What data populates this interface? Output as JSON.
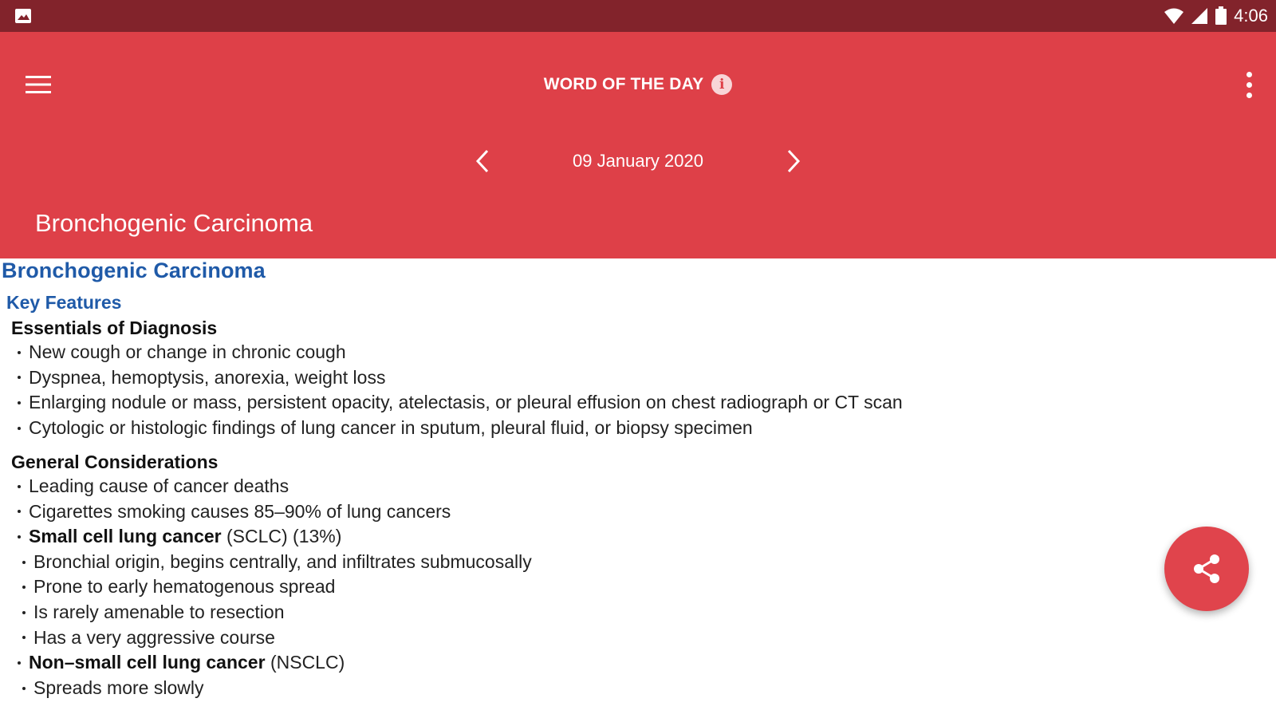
{
  "status_bar": {
    "time": "4:06",
    "icons": [
      "image-icon",
      "wifi-icon",
      "signal-icon",
      "battery-icon"
    ]
  },
  "app_bar": {
    "title": "WORD OF THE DAY",
    "info_icon": "i",
    "date": "09 January 2020",
    "word": "Bronchogenic Carcinoma"
  },
  "content": {
    "title": "Bronchogenic Carcinoma",
    "section": "Key Features",
    "essentials": {
      "heading": "Essentials of Diagnosis",
      "items": [
        "New cough or change in chronic cough",
        "Dyspnea, hemoptysis, anorexia, weight loss",
        "Enlarging nodule or mass, persistent opacity, atelectasis, or pleural effusion on chest radiograph or CT scan",
        "Cytologic or histologic findings of lung cancer in sputum, pleural fluid, or biopsy specimen"
      ]
    },
    "general": {
      "heading": "General Considerations",
      "items": [
        "Leading cause of cancer deaths",
        "Cigarettes smoking causes 85–90% of lung cancers"
      ],
      "sclc_bold": "Small cell lung cancer",
      "sclc_rest": " (SCLC) (13%)",
      "sclc_items": [
        "Bronchial origin, begins centrally, and infiltrates submucosally",
        "Prone to early hematogenous spread",
        "Is rarely amenable to resection",
        "Has a very aggressive course"
      ],
      "nsclc_bold": "Non–small cell lung cancer",
      "nsclc_rest": " (NSCLC)",
      "nsclc_items": [
        "Spreads more slowly"
      ]
    }
  },
  "colors": {
    "status_bar": "#82232b",
    "app_bar": "#de4048",
    "link_blue": "#1f5aa8",
    "fab": "#e0444c"
  }
}
